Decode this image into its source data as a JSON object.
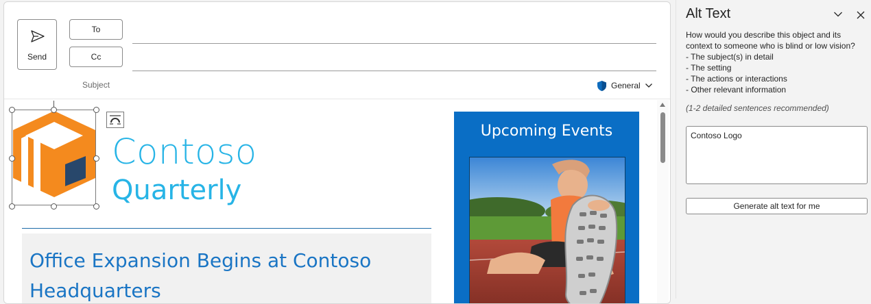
{
  "compose": {
    "send_label": "Send",
    "to_label": "To",
    "cc_label": "Cc",
    "subject_label": "Subject",
    "sensitivity_label": "General"
  },
  "body": {
    "brand_line1": "Contoso",
    "brand_line2": "Quarterly",
    "news_title": "Office Expansion Begins at Contoso Headquarters",
    "events_title": "Upcoming Events"
  },
  "alt_text_pane": {
    "title": "Alt Text",
    "prompt": "How would you describe this object and its context to someone who is blind or low vision?",
    "bullets": [
      "- The subject(s) in detail",
      "- The setting",
      "- The actions or interactions",
      "- Other relevant information"
    ],
    "note": "(1-2 detailed sentences recommended)",
    "alt_value": "Contoso Logo",
    "generate_label": "Generate alt text for me"
  },
  "colors": {
    "brand_blue": "#27b4e6",
    "logo_orange": "#f48a1e",
    "logo_navy": "#28476b",
    "events_blue": "#0a6ec5",
    "headline_blue": "#1a75c4"
  }
}
